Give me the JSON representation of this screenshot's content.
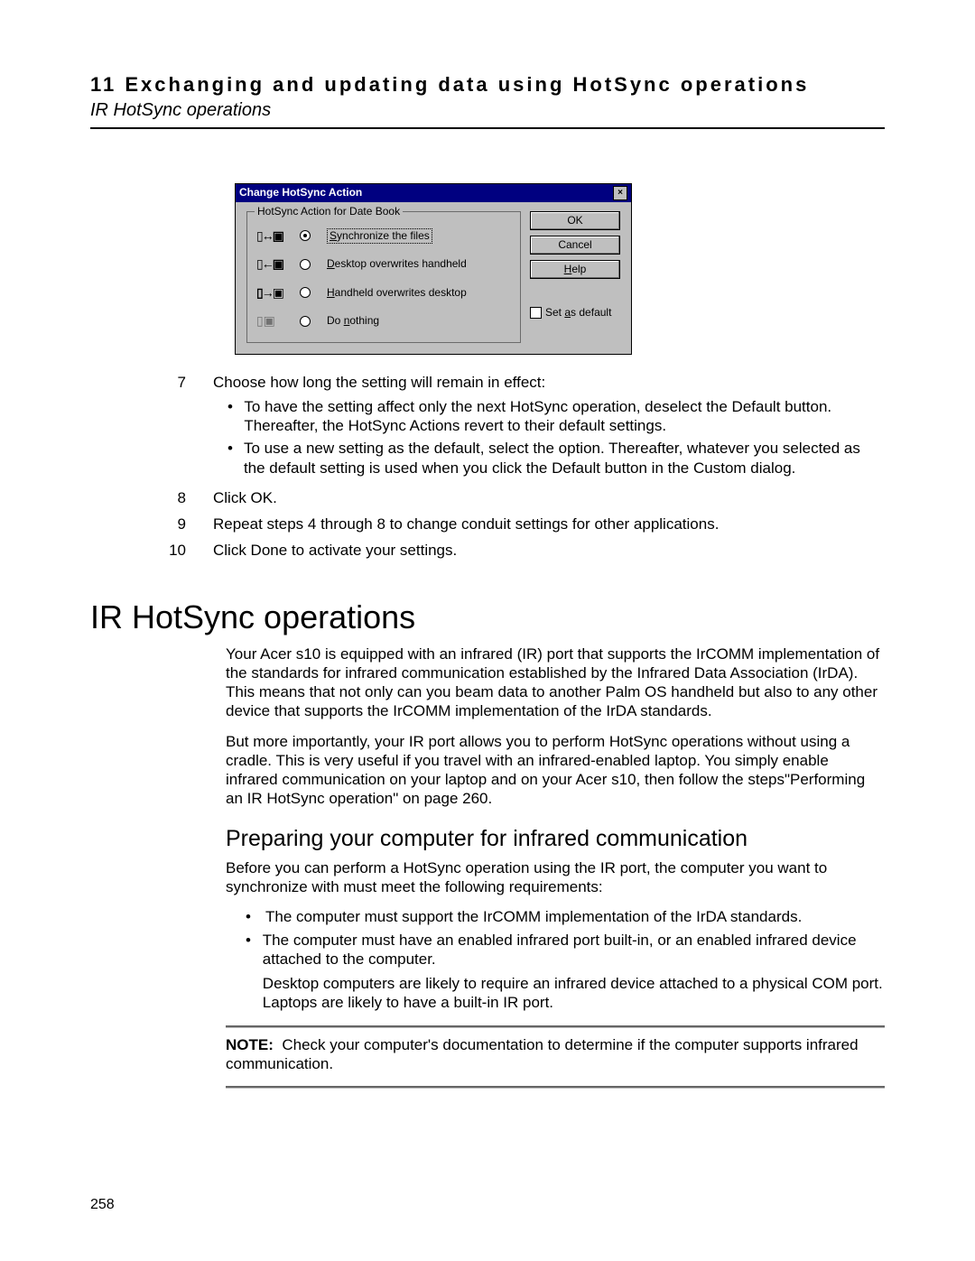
{
  "header": {
    "chapter": "11 Exchanging and updating data using HotSync operations",
    "section": "IR HotSync operations"
  },
  "dialog": {
    "title": "Change HotSync Action",
    "legend": "HotSync Action for Date Book",
    "options": {
      "sync": "Synchronize the files",
      "desktop": "Desktop overwrites handheld",
      "handheld": "Handheld overwrites desktop",
      "nothing": "Do nothing"
    },
    "buttons": {
      "ok": "OK",
      "cancel": "Cancel",
      "help": "Help"
    },
    "setdefault": "Set as default"
  },
  "steps": {
    "s7": {
      "n": "7",
      "text": "Choose how long the setting will remain in effect:",
      "b1": "To have the setting affect only the next HotSync operation, deselect the Default button. Thereafter, the HotSync Actions revert to their default settings.",
      "b2": "To use a new setting as the default, select the option. Thereafter, whatever you selected as the default setting is used when you click the Default button in the Custom dialog."
    },
    "s8": {
      "n": "8",
      "text": "Click OK."
    },
    "s9": {
      "n": "9",
      "text": "Repeat steps 4 through 8 to change conduit settings for other applications."
    },
    "s10": {
      "n": "10",
      "text": "Click Done to activate your settings."
    }
  },
  "h1": "IR HotSync operations",
  "para1": "Your Acer s10 is equipped with an infrared (IR) port that supports the IrCOMM implementation of the standards for infrared communication established by the Infrared Data Association (IrDA). This means that not only can you beam data to another Palm OS handheld but also to any other device that supports the IrCOMM implementation of the IrDA standards.",
  "para2": "But more importantly, your IR port allows you to perform HotSync operations without using a cradle. This is very useful if you travel with an infrared-enabled laptop. You simply enable infrared communication on your laptop and on your Acer s10, then follow the steps\"Performing an IR HotSync operation\" on page 260.",
  "h2": "Preparing your computer for infrared communication",
  "para3": "Before you can perform a HotSync operation using the IR port, the computer you want to synchronize with must meet the following requirements:",
  "req1": "The computer must support the IrCOMM implementation of the IrDA standards.",
  "req2": "The computer must have an enabled infrared port built-in, or an enabled infrared device attached to the computer.",
  "req2b": "Desktop computers are likely to require an infrared device attached to a physical COM port. Laptops are likely to have a built-in IR port.",
  "note_label": "NOTE:",
  "note_text": "Check your computer's documentation to determine if the computer supports infrared communication.",
  "page_number": "258"
}
